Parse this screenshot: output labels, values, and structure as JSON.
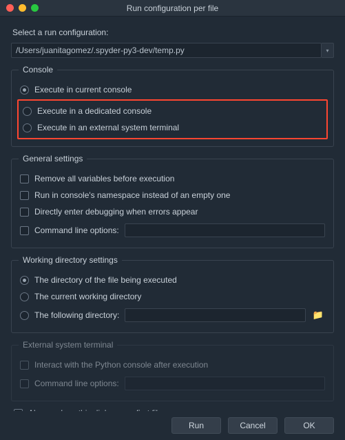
{
  "window": {
    "title": "Run configuration per file"
  },
  "prompt": "Select a run configuration:",
  "path": "/Users/juanitagomez/.spyder-py3-dev/temp.py",
  "console": {
    "legend": "Console",
    "opt_current": "Execute in current console",
    "opt_dedicated": "Execute in a dedicated console",
    "opt_external": "Execute in an external system terminal"
  },
  "general": {
    "legend": "General settings",
    "remove_vars": "Remove all variables before execution",
    "namespace": "Run in console's namespace instead of an empty one",
    "debug": "Directly enter debugging when errors appear",
    "cli": "Command line options:"
  },
  "workdir": {
    "legend": "Working directory settings",
    "file_dir": "The directory of the file being executed",
    "cwd": "The current working directory",
    "following": "The following directory:"
  },
  "external": {
    "legend": "External system terminal",
    "interact": "Interact with the Python console after execution",
    "cli": "Command line options:"
  },
  "always_show": "Always show this dialog on a first file run",
  "buttons": {
    "run": "Run",
    "cancel": "Cancel",
    "ok": "OK"
  }
}
